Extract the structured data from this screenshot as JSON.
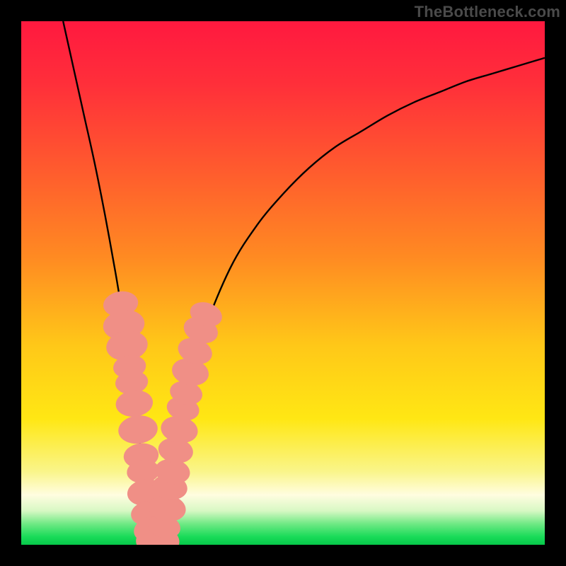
{
  "watermark": "TheBottleneck.com",
  "colors": {
    "frame": "#000000",
    "gradient_stops": [
      {
        "offset": 0.0,
        "color": "#ff193f"
      },
      {
        "offset": 0.12,
        "color": "#ff2f3a"
      },
      {
        "offset": 0.28,
        "color": "#ff5a2e"
      },
      {
        "offset": 0.45,
        "color": "#ff8a22"
      },
      {
        "offset": 0.62,
        "color": "#ffc818"
      },
      {
        "offset": 0.76,
        "color": "#ffe714"
      },
      {
        "offset": 0.86,
        "color": "#faf58a"
      },
      {
        "offset": 0.905,
        "color": "#fffde0"
      },
      {
        "offset": 0.935,
        "color": "#d8f8c4"
      },
      {
        "offset": 0.96,
        "color": "#6fe984"
      },
      {
        "offset": 0.985,
        "color": "#18db58"
      },
      {
        "offset": 1.0,
        "color": "#07c94a"
      }
    ],
    "curve": "#000000",
    "marker_fill": "#f08f86",
    "marker_stroke": "#e16a5f"
  },
  "chart_data": {
    "type": "line",
    "title": "",
    "xlabel": "",
    "ylabel": "",
    "xlim": [
      0,
      100
    ],
    "ylim": [
      0,
      100
    ],
    "series": [
      {
        "name": "bottleneck-curve",
        "x": [
          8,
          10,
          12,
          14,
          16,
          18,
          19,
          20,
          21,
          22,
          23,
          24,
          25,
          26,
          27,
          28,
          29,
          30,
          32,
          35,
          40,
          45,
          50,
          55,
          60,
          65,
          70,
          75,
          80,
          85,
          90,
          95,
          100
        ],
        "y": [
          100,
          91,
          82,
          73,
          63,
          52,
          46,
          40,
          33,
          25,
          16,
          7,
          2,
          0,
          2,
          8,
          14,
          20,
          30,
          41,
          53,
          61,
          67,
          72,
          76,
          79,
          82,
          84.5,
          86.5,
          88.5,
          90,
          91.5,
          93
        ]
      }
    ],
    "markers": [
      {
        "x": 19.0,
        "y": 46,
        "r": 3.2
      },
      {
        "x": 19.6,
        "y": 42,
        "r": 3.8
      },
      {
        "x": 20.2,
        "y": 38,
        "r": 3.8
      },
      {
        "x": 20.7,
        "y": 34,
        "r": 3.0
      },
      {
        "x": 21.1,
        "y": 31,
        "r": 3.0
      },
      {
        "x": 21.6,
        "y": 27,
        "r": 3.4
      },
      {
        "x": 22.3,
        "y": 22,
        "r": 3.6
      },
      {
        "x": 22.9,
        "y": 17,
        "r": 3.2
      },
      {
        "x": 23.3,
        "y": 14,
        "r": 3.0
      },
      {
        "x": 23.8,
        "y": 10,
        "r": 3.4
      },
      {
        "x": 24.3,
        "y": 6,
        "r": 3.2
      },
      {
        "x": 24.8,
        "y": 3,
        "r": 3.2
      },
      {
        "x": 25.4,
        "y": 1.2,
        "r": 3.4
      },
      {
        "x": 26.0,
        "y": 0.5,
        "r": 3.4
      },
      {
        "x": 26.7,
        "y": 1.0,
        "r": 3.4
      },
      {
        "x": 27.3,
        "y": 3.5,
        "r": 3.0
      },
      {
        "x": 27.9,
        "y": 7,
        "r": 3.4
      },
      {
        "x": 28.4,
        "y": 11,
        "r": 3.2
      },
      {
        "x": 28.9,
        "y": 14,
        "r": 3.2
      },
      {
        "x": 29.5,
        "y": 18,
        "r": 3.2
      },
      {
        "x": 30.2,
        "y": 22,
        "r": 3.4
      },
      {
        "x": 30.9,
        "y": 26,
        "r": 3.0
      },
      {
        "x": 31.5,
        "y": 29,
        "r": 3.0
      },
      {
        "x": 32.3,
        "y": 33,
        "r": 3.4
      },
      {
        "x": 33.2,
        "y": 37,
        "r": 3.2
      },
      {
        "x": 34.3,
        "y": 41,
        "r": 3.2
      },
      {
        "x": 35.3,
        "y": 44,
        "r": 3.0
      }
    ]
  }
}
